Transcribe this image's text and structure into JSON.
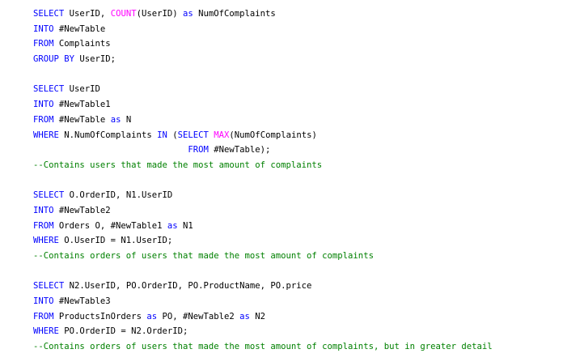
{
  "editor": {
    "colors": {
      "keyword": "#0000ff",
      "function": "#ff00ff",
      "comment": "#008000",
      "text": "#000000",
      "background": "#ffffff"
    },
    "lines": [
      [
        {
          "t": "kw",
          "v": "SELECT"
        },
        {
          "t": "tx",
          "v": " UserID, "
        },
        {
          "t": "fn",
          "v": "COUNT"
        },
        {
          "t": "tx",
          "v": "(UserID) "
        },
        {
          "t": "kw",
          "v": "as"
        },
        {
          "t": "tx",
          "v": " NumOfComplaints"
        }
      ],
      [
        {
          "t": "kw",
          "v": "INTO"
        },
        {
          "t": "tx",
          "v": " #NewTable"
        }
      ],
      [
        {
          "t": "kw",
          "v": "FROM"
        },
        {
          "t": "tx",
          "v": " Complaints"
        }
      ],
      [
        {
          "t": "kw",
          "v": "GROUP BY"
        },
        {
          "t": "tx",
          "v": " UserID;"
        }
      ],
      [],
      [
        {
          "t": "kw",
          "v": "SELECT"
        },
        {
          "t": "tx",
          "v": " UserID"
        }
      ],
      [
        {
          "t": "kw",
          "v": "INTO"
        },
        {
          "t": "tx",
          "v": " #NewTable1"
        }
      ],
      [
        {
          "t": "kw",
          "v": "FROM"
        },
        {
          "t": "tx",
          "v": " #NewTable "
        },
        {
          "t": "kw",
          "v": "as"
        },
        {
          "t": "tx",
          "v": " N"
        }
      ],
      [
        {
          "t": "kw",
          "v": "WHERE"
        },
        {
          "t": "tx",
          "v": " N.NumOfComplaints "
        },
        {
          "t": "kw",
          "v": "IN"
        },
        {
          "t": "tx",
          "v": " ("
        },
        {
          "t": "kw",
          "v": "SELECT"
        },
        {
          "t": "tx",
          "v": " "
        },
        {
          "t": "fn",
          "v": "MAX"
        },
        {
          "t": "tx",
          "v": "(NumOfComplaints)"
        }
      ],
      [
        {
          "t": "tx",
          "v": "                              "
        },
        {
          "t": "kw",
          "v": "FROM"
        },
        {
          "t": "tx",
          "v": " #NewTable);"
        }
      ],
      [
        {
          "t": "cm",
          "v": "--Contains users that made the most amount of complaints"
        }
      ],
      [],
      [
        {
          "t": "kw",
          "v": "SELECT"
        },
        {
          "t": "tx",
          "v": " O.OrderID, N1.UserID"
        }
      ],
      [
        {
          "t": "kw",
          "v": "INTO"
        },
        {
          "t": "tx",
          "v": " #NewTable2"
        }
      ],
      [
        {
          "t": "kw",
          "v": "FROM"
        },
        {
          "t": "tx",
          "v": " Orders O, #NewTable1 "
        },
        {
          "t": "kw",
          "v": "as"
        },
        {
          "t": "tx",
          "v": " N1"
        }
      ],
      [
        {
          "t": "kw",
          "v": "WHERE"
        },
        {
          "t": "tx",
          "v": " O.UserID = N1.UserID;"
        }
      ],
      [
        {
          "t": "cm",
          "v": "--Contains orders of users that made the most amount of complaints"
        }
      ],
      [],
      [
        {
          "t": "kw",
          "v": "SELECT"
        },
        {
          "t": "tx",
          "v": " N2.UserID, PO.OrderID, PO.ProductName, PO.price"
        }
      ],
      [
        {
          "t": "kw",
          "v": "INTO"
        },
        {
          "t": "tx",
          "v": " #NewTable3"
        }
      ],
      [
        {
          "t": "kw",
          "v": "FROM"
        },
        {
          "t": "tx",
          "v": " ProductsInOrders "
        },
        {
          "t": "kw",
          "v": "as"
        },
        {
          "t": "tx",
          "v": " PO, #NewTable2 "
        },
        {
          "t": "kw",
          "v": "as"
        },
        {
          "t": "tx",
          "v": " N2"
        }
      ],
      [
        {
          "t": "kw",
          "v": "WHERE"
        },
        {
          "t": "tx",
          "v": " PO.OrderID = N2.OrderID;"
        }
      ],
      [
        {
          "t": "cm",
          "v": "--Contains orders of users that made the most amount of complaints, but in greater detail"
        }
      ]
    ]
  }
}
